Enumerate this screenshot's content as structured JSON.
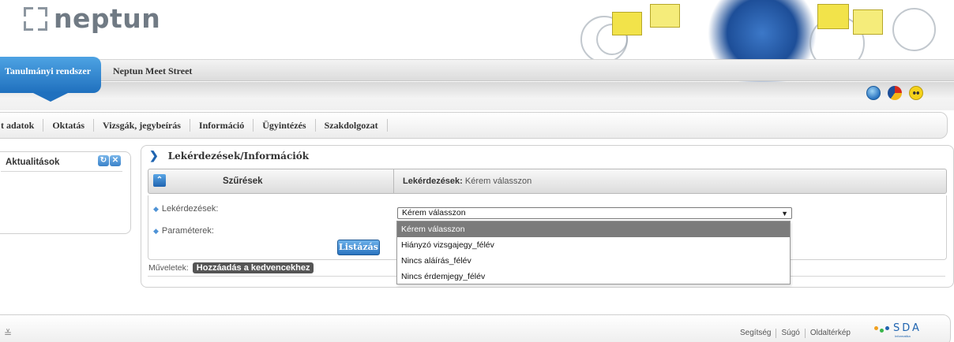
{
  "app": {
    "logo_text": "neptun"
  },
  "header": {
    "active_tab": "Tanulmányi rendszer",
    "secondary_tab": "Neptun Meet Street",
    "icons": [
      "globe-icon",
      "theme-icon",
      "accessibility-icon"
    ]
  },
  "nav": {
    "items": [
      "t adatok",
      "Oktatás",
      "Vizsgák, jegybeírás",
      "Információ",
      "Ügyintézés",
      "Szakdolgozat"
    ]
  },
  "sidebar": {
    "title": "Aktualitások"
  },
  "main": {
    "title": "Lekérdezések/Információk",
    "filter_label": "Szűrések",
    "filter_status_label": "Lekérdezések:",
    "filter_status_value": "Kérem válasszon",
    "queries_label": "Lekérdezések:",
    "params_label": "Paraméterek:",
    "select_value": "Kérem válasszon",
    "list_button": "Listázás",
    "ops_label": "Műveletek:",
    "fav_button": "Hozzáadás a kedvencekhez"
  },
  "dropdown": {
    "options": [
      "Kérem válasszon",
      "Hiányzó vizsgajegy_félév",
      "Nincs aláírás_félév",
      "Nincs érdemjegy_félév"
    ],
    "selected": "Kérem válasszon"
  },
  "footer": {
    "links": [
      "Segítség",
      "Súgó",
      "Oldaltérkép"
    ],
    "brand": "SDA",
    "brand_sub": "Informatika"
  }
}
